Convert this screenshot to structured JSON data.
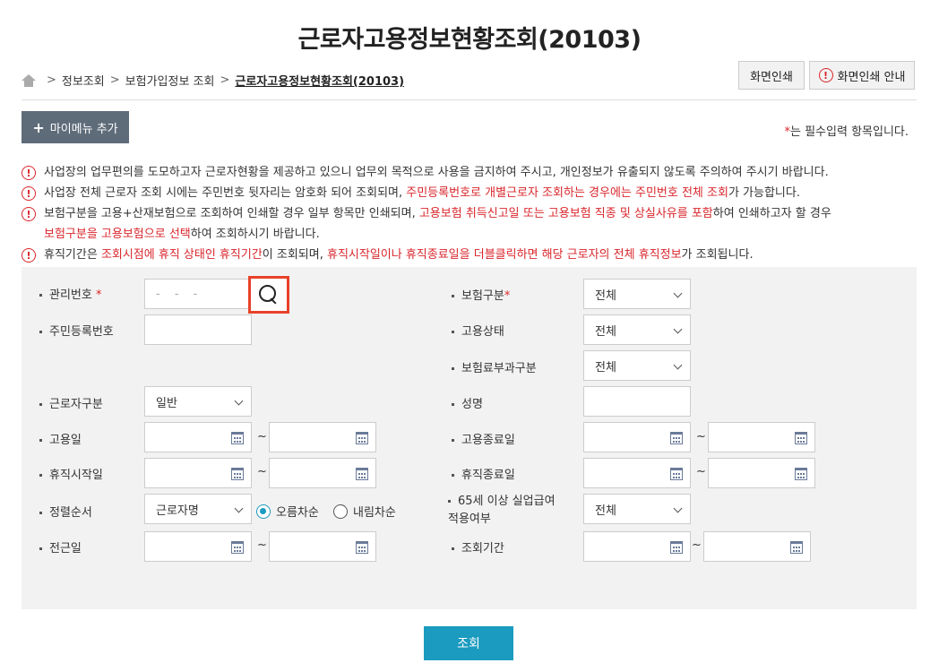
{
  "page": {
    "title": "근로자고용정보현황조회(20103)"
  },
  "breadcrumb": {
    "items": [
      "정보조회",
      "보험가입정보 조회"
    ],
    "current": "근로자고용정보현황조회(20103)"
  },
  "header": {
    "print_label": "화면인쇄",
    "print_guide_label": "화면인쇄 안내"
  },
  "mymenu": {
    "label": "마이메뉴 추가"
  },
  "required_note": {
    "star": "*",
    "text": "는 필수입력 항목입니다."
  },
  "notices": [
    {
      "parts": [
        {
          "t": "사업장의 업무편의를 도모하고자 근로자현황을 제공하고 있으니 업무외 목적으로 사용을 금지하여 주시고, 개인정보가 유출되지 않도록 주의하여 주시기 바랍니다.",
          "red": false
        }
      ]
    },
    {
      "parts": [
        {
          "t": "사업장 전체 근로자 조회 시에는 주민번호 뒷자리는 암호화 되어 조회되며, ",
          "red": false
        },
        {
          "t": "주민등록번호로 개별근로자 조회하는 경우에는 주민번호 전체 조회",
          "red": true
        },
        {
          "t": "가 가능합니다.",
          "red": false
        }
      ]
    },
    {
      "parts": [
        {
          "t": "보험구분을 고용+산재보험으로 조회하여 인쇄할 경우 일부 항목만 인쇄되며, ",
          "red": false
        },
        {
          "t": "고용보험 취득신고일 또는 고용보험 직종 및 상실사유를 포함",
          "red": true
        },
        {
          "t": "하여 인쇄하고자 할 경우",
          "red": false
        }
      ]
    },
    {
      "parts": [
        {
          "t": "보험구분을 고용보험으로 선택",
          "red": true
        },
        {
          "t": "하여 조회하시기 바랍니다.",
          "red": false
        }
      ],
      "continuation": true
    },
    {
      "parts": [
        {
          "t": "휴직기간은 ",
          "red": false
        },
        {
          "t": "조회시점에 휴직 상태인 휴직기간",
          "red": true
        },
        {
          "t": "이 조회되며, ",
          "red": false
        },
        {
          "t": "휴직시작일이나 휴직종료일을 더블클릭하면 해당 근로자의 전체 휴직정보",
          "red": true
        },
        {
          "t": "가 조회됩니다.",
          "red": false
        }
      ]
    }
  ],
  "form": {
    "mgmt_no_label": "관리번호",
    "mgmt_no_placeholder": "- - -",
    "rrn_label": "주민등록번호",
    "worker_type_label": "근로자구분",
    "worker_type_value": "일반",
    "hire_date_label": "고용일",
    "leave_start_label": "휴직시작일",
    "sort_label": "정렬순서",
    "sort_value": "근로자명",
    "asc_label": "오름차순",
    "desc_label": "내림차순",
    "transfer_label": "전근일",
    "insurance_label": "보험구분",
    "insurance_value": "전체",
    "emp_status_label": "고용상태",
    "emp_status_value": "전체",
    "premium_label": "보험료부과구분",
    "premium_value": "전체",
    "name_label": "성명",
    "emp_end_label": "고용종료일",
    "leave_end_label": "휴직종료일",
    "over65_label_1": "65세 이상 실업급여",
    "over65_label_2": "적용여부",
    "over65_value": "전체",
    "period_label": "조회기간",
    "tilde": "~",
    "star": "*"
  },
  "submit": {
    "label": "조회"
  },
  "colors": {
    "accent": "#1a9bbf",
    "alert": "#d9262c",
    "highlight": "#e8422a",
    "mymenu_bg": "#5e6b79"
  }
}
